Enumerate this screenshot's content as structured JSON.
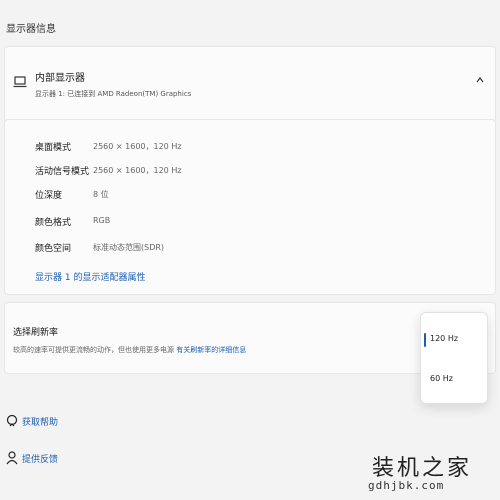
{
  "section_title": "显示器信息",
  "display": {
    "title": "内部显示器",
    "subtitle": "显示器 1: 已连接到 AMD Radeon(TM) Graphics",
    "icon": "laptop-icon",
    "collapse_icon": "chevron-up-icon"
  },
  "details": {
    "rows": [
      {
        "label": "桌面模式",
        "value": "2560 × 1600，120 Hz"
      },
      {
        "label": "活动信号模式",
        "value": "2560 × 1600，120 Hz"
      },
      {
        "label": "位深度",
        "value": "8 位"
      },
      {
        "label": "颜色格式",
        "value": "RGB"
      },
      {
        "label": "颜色空间",
        "value": "标准动态范围(SDR)"
      }
    ],
    "adapter_link": "显示器 1 的显示适配器属性"
  },
  "refresh": {
    "title": "选择刷新率",
    "description": "较高的速率可提供更流畅的动作，但也使用更多电源",
    "link": "有关刷新率的详细信息",
    "options": [
      "120 Hz",
      "60 Hz"
    ],
    "selected": "120 Hz",
    "accent": "#1b5fb0"
  },
  "help": {
    "get_help": "获取帮助",
    "feedback": "提供反馈"
  },
  "watermark": {
    "name": "装机之家",
    "url": "gdhjbk.com"
  }
}
